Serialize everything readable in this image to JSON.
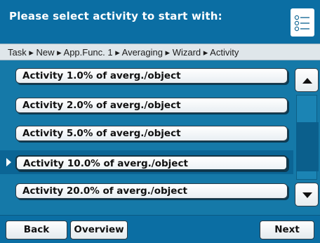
{
  "header": {
    "title": "Please select activity to start with:",
    "menu_icon": "list-menu-icon"
  },
  "breadcrumb": {
    "text": "Task ▸ New ▸ App.Func. 1 ▸ Averaging ▸ Wizard ▸ Activity"
  },
  "list": {
    "items": [
      {
        "label": "Activity 1.0% of averg./object",
        "selected": false
      },
      {
        "label": "Activity 2.0% of averg./object",
        "selected": false
      },
      {
        "label": "Activity 5.0% of averg./object",
        "selected": false
      },
      {
        "label": "Activity 10.0% of averg./object",
        "selected": true
      },
      {
        "label": "Activity 20.0% of averg./object",
        "selected": false
      }
    ]
  },
  "scrollbar": {
    "up_icon": "arrow-up-icon",
    "down_icon": "arrow-down-icon"
  },
  "footer": {
    "back_label": "Back",
    "overview_label": "Overview",
    "next_label": "Next"
  },
  "colors": {
    "background": "#1579a8",
    "header": "#0b6ea3",
    "selected_row": "#0b6595"
  }
}
